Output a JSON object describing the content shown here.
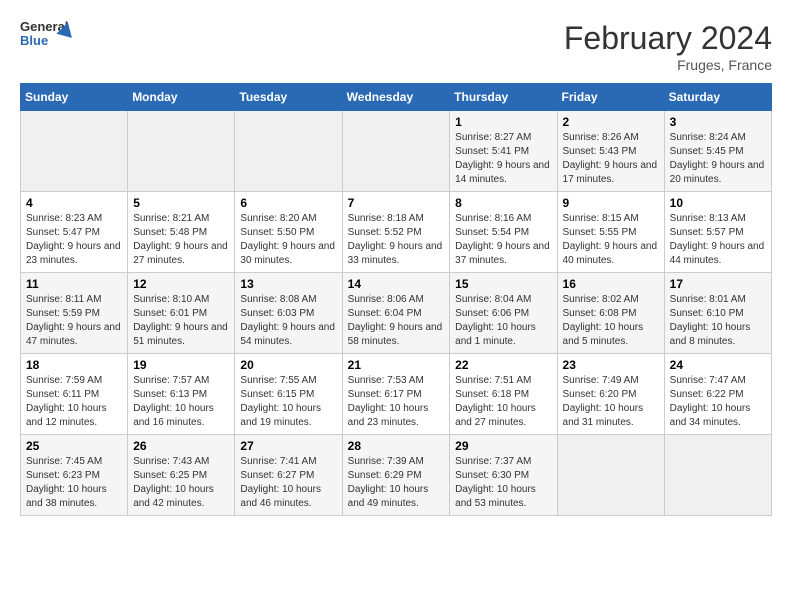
{
  "header": {
    "logo_general": "General",
    "logo_blue": "Blue",
    "month_year": "February 2024",
    "location": "Fruges, France"
  },
  "days_of_week": [
    "Sunday",
    "Monday",
    "Tuesday",
    "Wednesday",
    "Thursday",
    "Friday",
    "Saturday"
  ],
  "weeks": [
    [
      {
        "day": "",
        "info": ""
      },
      {
        "day": "",
        "info": ""
      },
      {
        "day": "",
        "info": ""
      },
      {
        "day": "",
        "info": ""
      },
      {
        "day": "1",
        "sunrise": "8:27 AM",
        "sunset": "5:41 PM",
        "daylight": "9 hours and 14 minutes."
      },
      {
        "day": "2",
        "sunrise": "8:26 AM",
        "sunset": "5:43 PM",
        "daylight": "9 hours and 17 minutes."
      },
      {
        "day": "3",
        "sunrise": "8:24 AM",
        "sunset": "5:45 PM",
        "daylight": "9 hours and 20 minutes."
      }
    ],
    [
      {
        "day": "4",
        "sunrise": "8:23 AM",
        "sunset": "5:47 PM",
        "daylight": "9 hours and 23 minutes."
      },
      {
        "day": "5",
        "sunrise": "8:21 AM",
        "sunset": "5:48 PM",
        "daylight": "9 hours and 27 minutes."
      },
      {
        "day": "6",
        "sunrise": "8:20 AM",
        "sunset": "5:50 PM",
        "daylight": "9 hours and 30 minutes."
      },
      {
        "day": "7",
        "sunrise": "8:18 AM",
        "sunset": "5:52 PM",
        "daylight": "9 hours and 33 minutes."
      },
      {
        "day": "8",
        "sunrise": "8:16 AM",
        "sunset": "5:54 PM",
        "daylight": "9 hours and 37 minutes."
      },
      {
        "day": "9",
        "sunrise": "8:15 AM",
        "sunset": "5:55 PM",
        "daylight": "9 hours and 40 minutes."
      },
      {
        "day": "10",
        "sunrise": "8:13 AM",
        "sunset": "5:57 PM",
        "daylight": "9 hours and 44 minutes."
      }
    ],
    [
      {
        "day": "11",
        "sunrise": "8:11 AM",
        "sunset": "5:59 PM",
        "daylight": "9 hours and 47 minutes."
      },
      {
        "day": "12",
        "sunrise": "8:10 AM",
        "sunset": "6:01 PM",
        "daylight": "9 hours and 51 minutes."
      },
      {
        "day": "13",
        "sunrise": "8:08 AM",
        "sunset": "6:03 PM",
        "daylight": "9 hours and 54 minutes."
      },
      {
        "day": "14",
        "sunrise": "8:06 AM",
        "sunset": "6:04 PM",
        "daylight": "9 hours and 58 minutes."
      },
      {
        "day": "15",
        "sunrise": "8:04 AM",
        "sunset": "6:06 PM",
        "daylight": "10 hours and 1 minute."
      },
      {
        "day": "16",
        "sunrise": "8:02 AM",
        "sunset": "6:08 PM",
        "daylight": "10 hours and 5 minutes."
      },
      {
        "day": "17",
        "sunrise": "8:01 AM",
        "sunset": "6:10 PM",
        "daylight": "10 hours and 8 minutes."
      }
    ],
    [
      {
        "day": "18",
        "sunrise": "7:59 AM",
        "sunset": "6:11 PM",
        "daylight": "10 hours and 12 minutes."
      },
      {
        "day": "19",
        "sunrise": "7:57 AM",
        "sunset": "6:13 PM",
        "daylight": "10 hours and 16 minutes."
      },
      {
        "day": "20",
        "sunrise": "7:55 AM",
        "sunset": "6:15 PM",
        "daylight": "10 hours and 19 minutes."
      },
      {
        "day": "21",
        "sunrise": "7:53 AM",
        "sunset": "6:17 PM",
        "daylight": "10 hours and 23 minutes."
      },
      {
        "day": "22",
        "sunrise": "7:51 AM",
        "sunset": "6:18 PM",
        "daylight": "10 hours and 27 minutes."
      },
      {
        "day": "23",
        "sunrise": "7:49 AM",
        "sunset": "6:20 PM",
        "daylight": "10 hours and 31 minutes."
      },
      {
        "day": "24",
        "sunrise": "7:47 AM",
        "sunset": "6:22 PM",
        "daylight": "10 hours and 34 minutes."
      }
    ],
    [
      {
        "day": "25",
        "sunrise": "7:45 AM",
        "sunset": "6:23 PM",
        "daylight": "10 hours and 38 minutes."
      },
      {
        "day": "26",
        "sunrise": "7:43 AM",
        "sunset": "6:25 PM",
        "daylight": "10 hours and 42 minutes."
      },
      {
        "day": "27",
        "sunrise": "7:41 AM",
        "sunset": "6:27 PM",
        "daylight": "10 hours and 46 minutes."
      },
      {
        "day": "28",
        "sunrise": "7:39 AM",
        "sunset": "6:29 PM",
        "daylight": "10 hours and 49 minutes."
      },
      {
        "day": "29",
        "sunrise": "7:37 AM",
        "sunset": "6:30 PM",
        "daylight": "10 hours and 53 minutes."
      },
      {
        "day": "",
        "info": ""
      },
      {
        "day": "",
        "info": ""
      }
    ]
  ]
}
